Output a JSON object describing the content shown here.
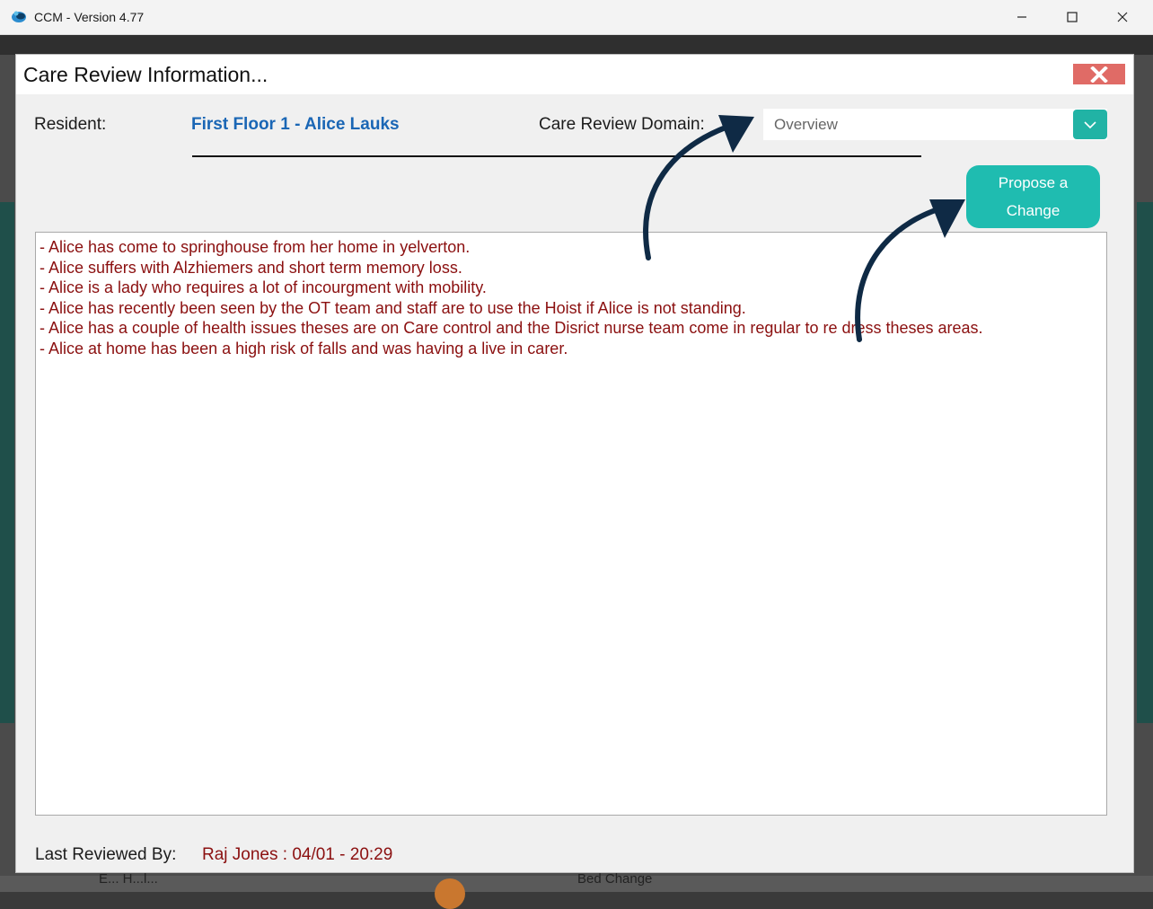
{
  "os_window": {
    "title": "CCM - Version 4.77",
    "minimize_glyph": "—",
    "maximize_glyph": "☐",
    "close_glyph": "✕"
  },
  "background": {
    "fragment_1": "Bed Change",
    "fragment_2": "E... H...l..."
  },
  "dialog": {
    "title": "Care Review Information...",
    "close_icon": "close-x-icon",
    "resident_label": "Resident:",
    "resident_name": "First Floor 1 - Alice Lauks",
    "domain_label": "Care Review Domain:",
    "domain_value": "Overview",
    "domain_dropdown_icon": "chevron-down-icon",
    "propose_button": "Propose a Change",
    "notes": [
      "- Alice has come to springhouse from her home in yelverton.",
      "- Alice suffers with Alzhiemers and short term memory loss.",
      "- Alice is a lady who requires a lot of incourgment with mobility.",
      "- Alice has recently been seen by the OT team and staff are to use the Hoist if Alice is not standing.",
      "- Alice has a couple of health issues theses are on Care control and the Disrict nurse team come in regular to re dress theses areas.",
      "- Alice at home has been a high risk of falls and was having a live in carer."
    ],
    "last_reviewed_label": "Last Reviewed By:",
    "last_reviewed_value": "Raj Jones : 04/01 - 20:29"
  },
  "colors": {
    "accent_teal": "#1fbcb0",
    "resident_blue": "#1a66b5",
    "note_red": "#8b1010",
    "close_red": "#e06b66",
    "annotation_arrow": "#0f2a45"
  }
}
